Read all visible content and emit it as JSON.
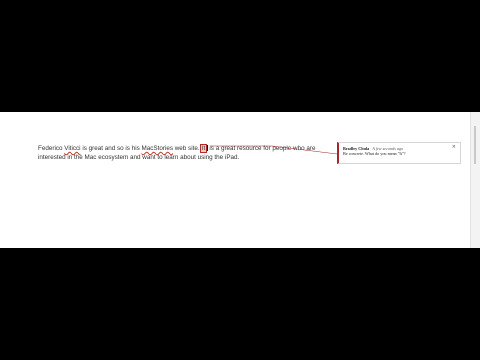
{
  "document": {
    "paragraph": {
      "segments": [
        {
          "key": "s1",
          "text": "Federico "
        },
        {
          "key": "s2",
          "text": "Viticci",
          "style": "spell"
        },
        {
          "key": "s3",
          "text": " is great and so is his "
        },
        {
          "key": "s4",
          "text": "MacStories",
          "style": "spell"
        },
        {
          "key": "s5",
          "text": " web site. "
        },
        {
          "key": "s6",
          "text": "It",
          "style": "comment-highlight"
        },
        {
          "key": "s7",
          "text": " is a great resource for people who are interested in the Mac ecosystem and want to learn about using the iPad."
        }
      ]
    }
  },
  "comment": {
    "author": "Bradley Chula",
    "time": "A few seconds ago",
    "body": "Be concrete. What do you mean \"It\"?",
    "close_glyph": "×"
  },
  "colors": {
    "comment_accent": "#a4262c",
    "highlight": "#f6c9c9",
    "spell_underline": "#c0392b"
  }
}
